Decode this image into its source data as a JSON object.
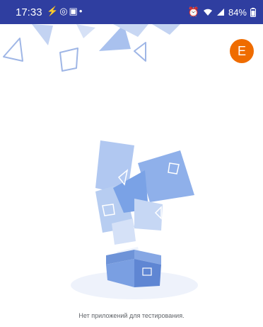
{
  "status_bar": {
    "time": "17:33",
    "battery": "84%",
    "background": "#2f3ea0"
  },
  "profile": {
    "avatar_letter": "E",
    "avatar_color": "#ef6c00"
  },
  "empty_state": {
    "message": "Нет приложений для тестирования."
  }
}
